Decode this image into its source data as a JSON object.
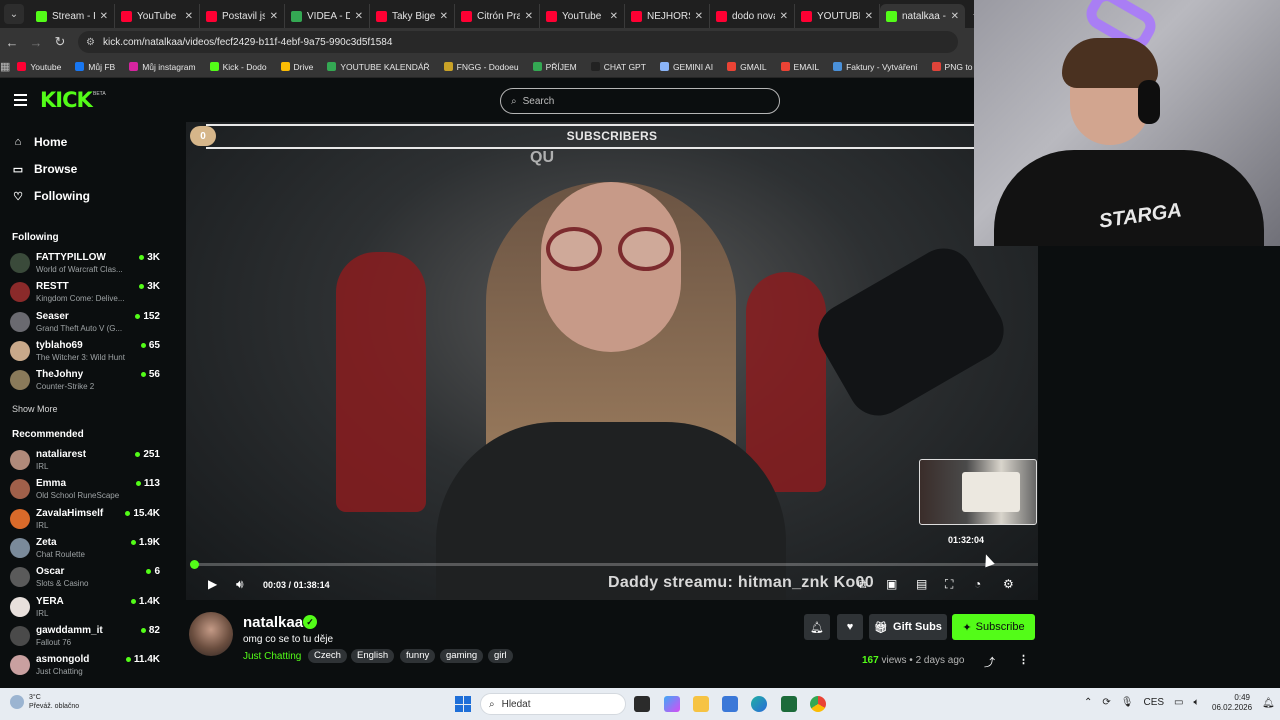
{
  "browser": {
    "tabs": [
      {
        "label": "Stream - K",
        "color": "#53fc18",
        "active": false
      },
      {
        "label": "YouTube",
        "color": "#ff0033",
        "active": false
      },
      {
        "label": "Postavil jsi",
        "color": "#ff0033",
        "active": false
      },
      {
        "label": "VIDEA - D",
        "color": "#34a853",
        "active": false
      },
      {
        "label": "Taky Bige",
        "color": "#ff0033",
        "active": false
      },
      {
        "label": "Citrón Pra",
        "color": "#ff0033",
        "active": false
      },
      {
        "label": "YouTube",
        "color": "#ff0033",
        "active": false
      },
      {
        "label": "NEJHORŠÍ",
        "color": "#ff0033",
        "active": false
      },
      {
        "label": "dodo nová",
        "color": "#ff0033",
        "active": false
      },
      {
        "label": "YOUTUBE",
        "color": "#ff0033",
        "active": false
      },
      {
        "label": "natalkaa -",
        "color": "#53fc18",
        "active": true
      }
    ],
    "url": "kick.com/natalkaa/videos/fecf2429-b11f-4ebf-9a75-990c3d5f1584",
    "bookmarks": [
      {
        "label": "Youtube",
        "color": "#ff0033"
      },
      {
        "label": "Můj FB",
        "color": "#1877f2"
      },
      {
        "label": "Můj instagram",
        "color": "#d6249f"
      },
      {
        "label": "Kick - Dodo",
        "color": "#53fc18"
      },
      {
        "label": "Drive",
        "color": "#fbbc04"
      },
      {
        "label": "YOUTUBE KALENDÁŘ",
        "color": "#34a853"
      },
      {
        "label": "FNGG - Dodoeu",
        "color": "#c9a227"
      },
      {
        "label": "PŘÍJEM",
        "color": "#34a853"
      },
      {
        "label": "CHAT GPT",
        "color": "#222222"
      },
      {
        "label": "GEMINI AI",
        "color": "#8ab4f8"
      },
      {
        "label": "GMAIL",
        "color": "#ea4335"
      },
      {
        "label": "EMAIL",
        "color": "#ea4335"
      },
      {
        "label": "Faktury - Vytváření",
        "color": "#4a90d9"
      },
      {
        "label": "PNG to PDF",
        "color": "#e0443a"
      }
    ]
  },
  "kick": {
    "logo": "KICK",
    "beta": "BETA",
    "search_placeholder": "Search",
    "accent": "#53fc18"
  },
  "sidebar": {
    "nav": [
      {
        "label": "Home",
        "icon": "home-icon"
      },
      {
        "label": "Browse",
        "icon": "browse-icon"
      },
      {
        "label": "Following",
        "icon": "heart-icon"
      }
    ],
    "following_heading": "Following",
    "following": [
      {
        "name": "FATTYPILLOW",
        "game": "World of Warcraft Clas...",
        "viewers": "3K",
        "avatar": "#3a4a3a"
      },
      {
        "name": "RESTT",
        "game": "Kingdom Come: Delive...",
        "viewers": "3K",
        "avatar": "#8a2a2a"
      },
      {
        "name": "Seaser",
        "game": "Grand Theft Auto V (G...",
        "viewers": "152",
        "avatar": "#6a6a70"
      },
      {
        "name": "tyblaho69",
        "game": "The Witcher 3: Wild Hunt",
        "viewers": "65",
        "avatar": "#c9a98a"
      },
      {
        "name": "TheJohny",
        "game": "Counter-Strike 2",
        "viewers": "56",
        "avatar": "#8a7a5a"
      }
    ],
    "show_more": "Show More",
    "recommended_heading": "Recommended",
    "recommended": [
      {
        "name": "nataliarest",
        "game": "IRL",
        "viewers": "251",
        "avatar": "#b08a7a"
      },
      {
        "name": "Emma",
        "game": "Old School RuneScape",
        "viewers": "113",
        "avatar": "#a0604a"
      },
      {
        "name": "ZavalaHimself",
        "game": "IRL",
        "viewers": "15.4K",
        "avatar": "#d96a2a"
      },
      {
        "name": "Zeta",
        "game": "Chat Roulette",
        "viewers": "1.9K",
        "avatar": "#7a8a9a"
      },
      {
        "name": "Oscar",
        "game": "Slots & Casino",
        "viewers": "6",
        "avatar": "#5a5a5a"
      },
      {
        "name": "YERA",
        "game": "IRL",
        "viewers": "1.4K",
        "avatar": "#e8e0dc"
      },
      {
        "name": "gawddamm_it",
        "game": "Fallout 76",
        "viewers": "82",
        "avatar": "#4a4a4a"
      },
      {
        "name": "asmongold",
        "game": "Just Chatting",
        "viewers": "11.4K",
        "avatar": "#c9a0a0"
      }
    ]
  },
  "player": {
    "sub_count": "0",
    "sub_title": "SUBSCRIBERS",
    "overlay_text": "QU",
    "hover_time": "01:32:04",
    "current_time": "00:03",
    "separator": "/",
    "duration": "01:38:14",
    "progress_fraction": 0.002,
    "ticker": "Daddy streamu: hitman_znk  Ko00"
  },
  "video_info": {
    "streamer": "natalkaa",
    "title": "omg co se to tu děje",
    "category": "Just Chatting",
    "tags": [
      "Czech",
      "English",
      "funny",
      "gaming",
      "girl"
    ],
    "gift_subs": "Gift Subs",
    "subscribe": "Subscribe",
    "views": "167",
    "views_label": "views",
    "dot": "•",
    "age": "2 days ago"
  },
  "webcam": {
    "shirt_text": "STARGA"
  },
  "taskbar": {
    "temp": "3°C",
    "weather": "Převáž. oblačno",
    "search": "Hledat",
    "lang": "CES",
    "time": "0:49",
    "date": "06.02.2026"
  }
}
